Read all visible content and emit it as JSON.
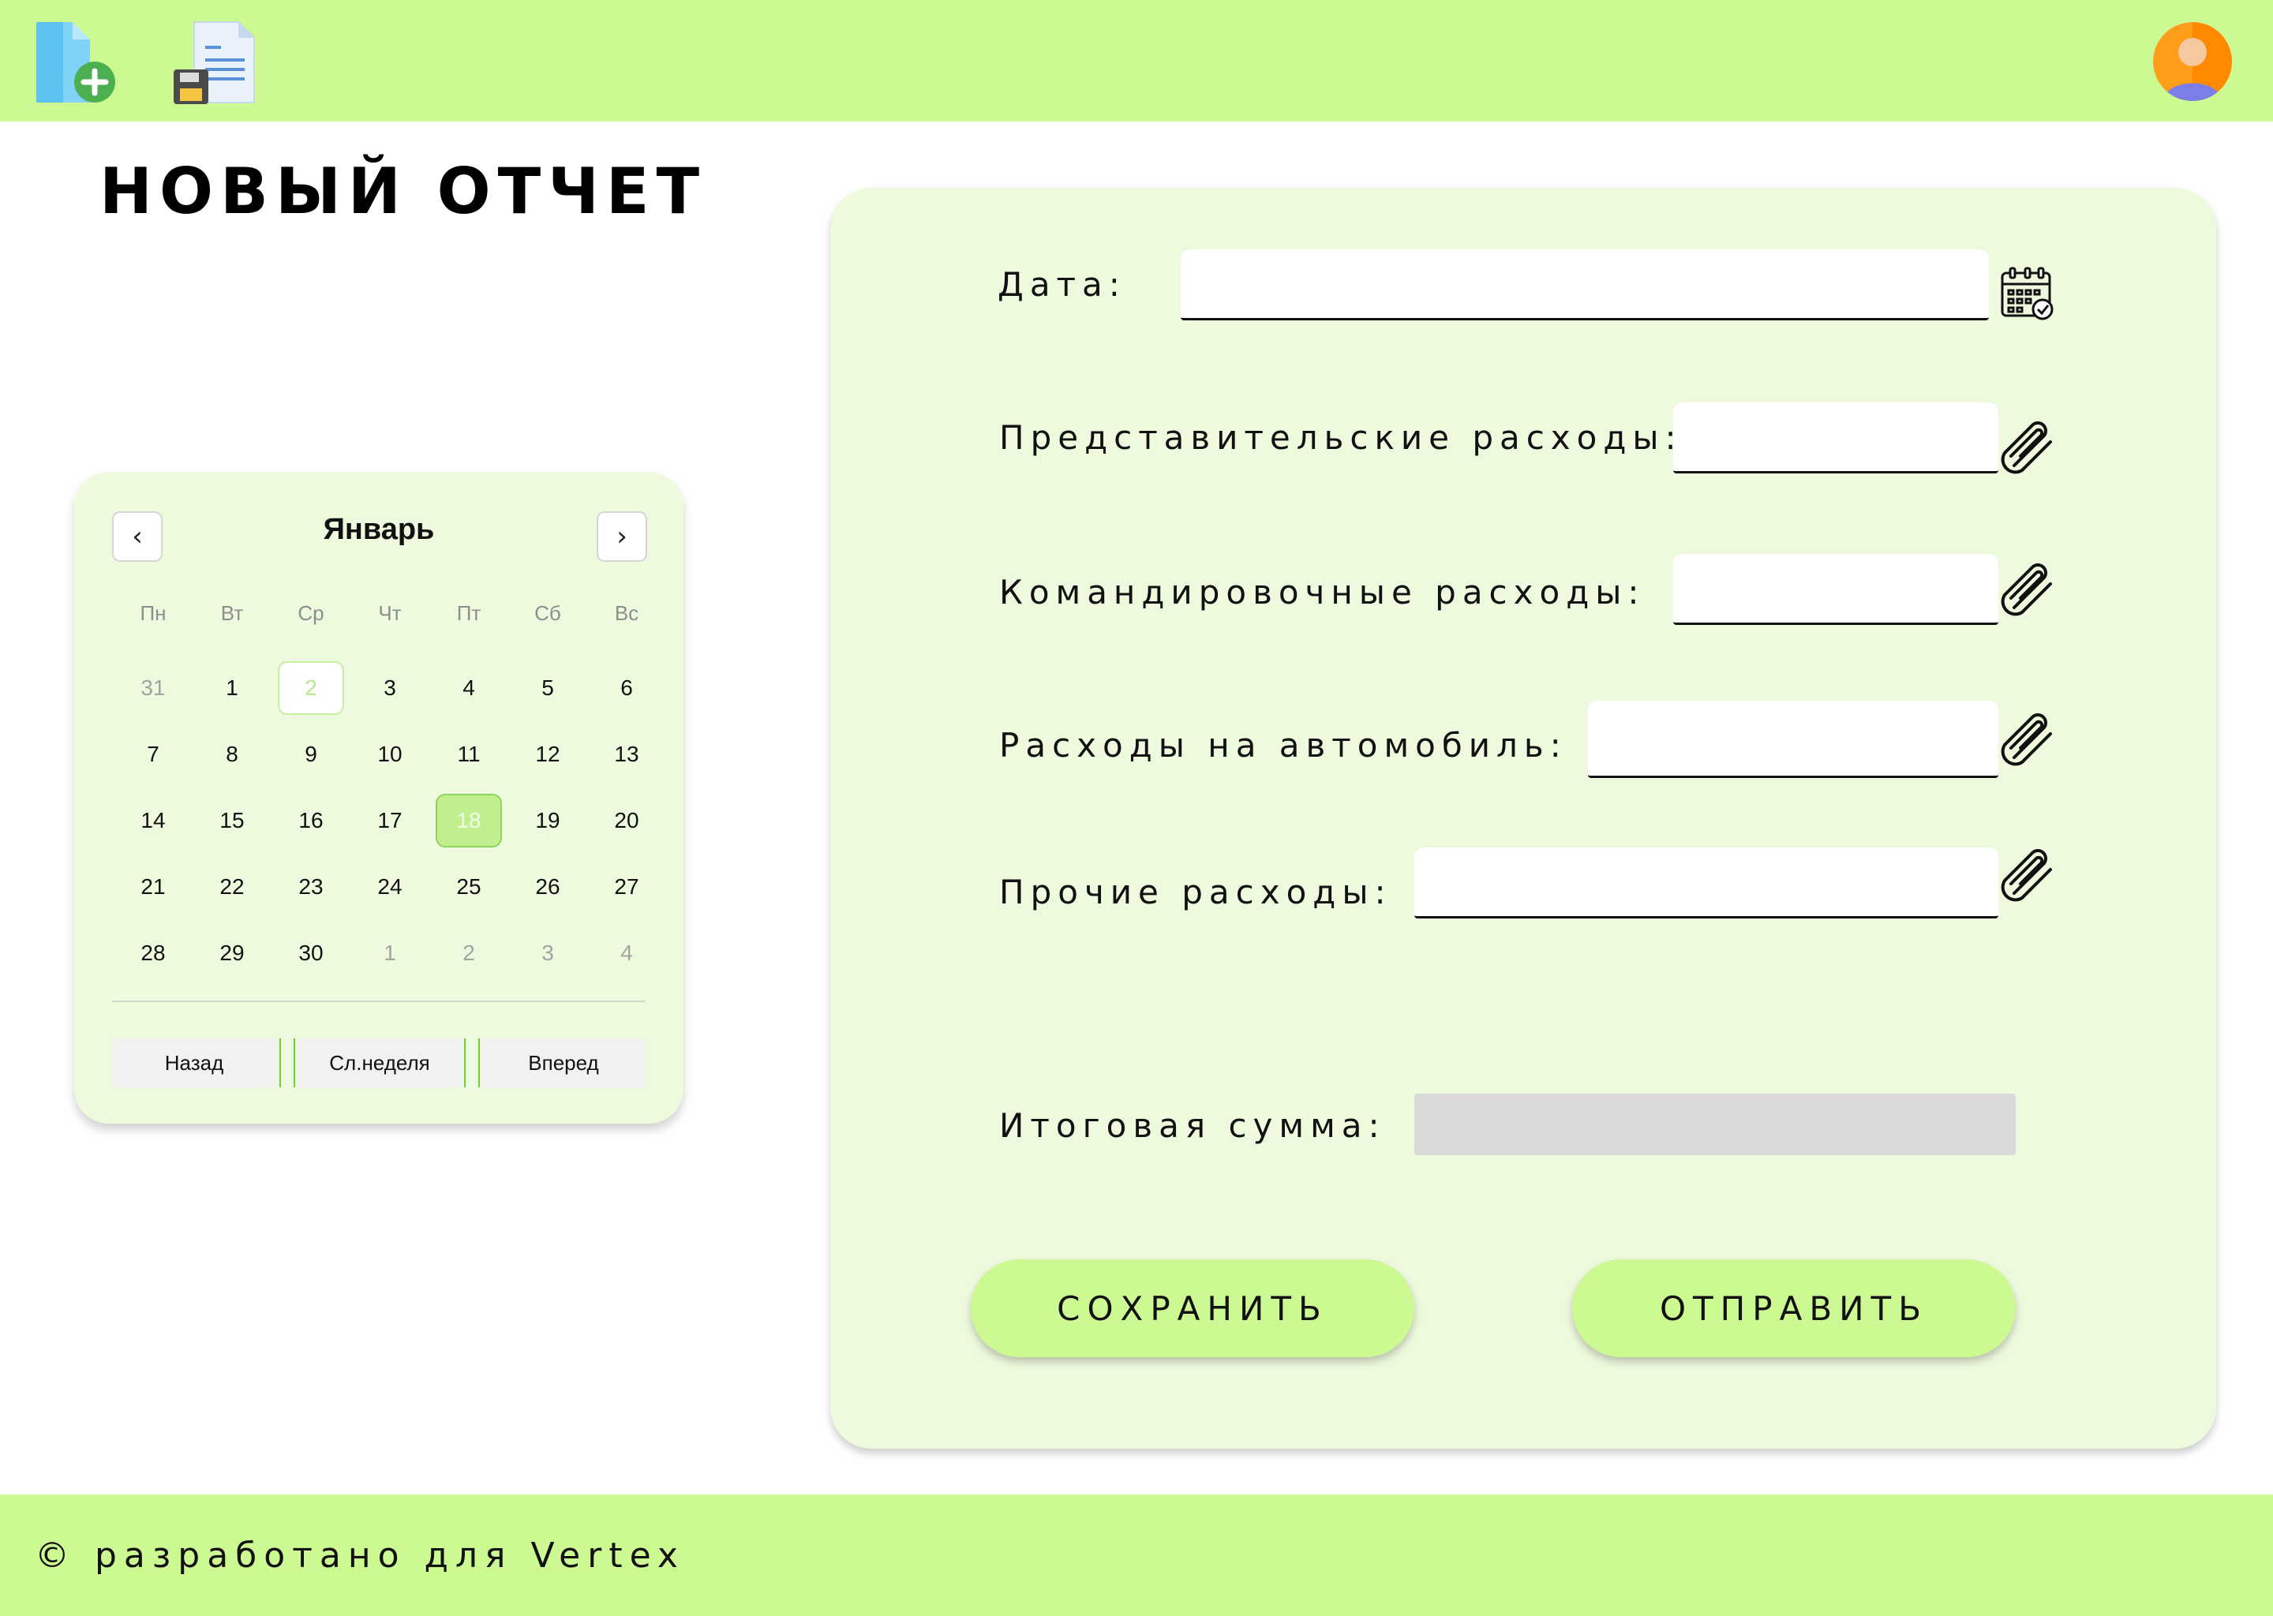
{
  "header": {
    "icons": [
      "new-document-icon",
      "save-document-icon"
    ],
    "avatar": "user-avatar"
  },
  "page": {
    "title": "НОВЫЙ ОТЧЕТ"
  },
  "calendar": {
    "month": "Январь",
    "prev_icon": "‹",
    "next_icon": "›",
    "weekdays": [
      "Пн",
      "Вт",
      "Ср",
      "Чт",
      "Пт",
      "Сб",
      "Вс"
    ],
    "days": [
      "31",
      "1",
      "2",
      "3",
      "4",
      "5",
      "6",
      "7",
      "8",
      "9",
      "10",
      "11",
      "12",
      "13",
      "14",
      "15",
      "16",
      "17",
      "18",
      "19",
      "20",
      "21",
      "22",
      "23",
      "24",
      "25",
      "26",
      "27",
      "28",
      "29",
      "30",
      "1",
      "2",
      "3",
      "4"
    ],
    "today": "2",
    "selected": "18",
    "buttons": {
      "back": "Назад",
      "next_week": "Сл.неделя",
      "forward": "Вперед"
    }
  },
  "form": {
    "date_label": "Дата:",
    "date_value": "",
    "representation_label": "Представительские расходы:",
    "representation_value": "",
    "travel_label": "Командировочные расходы:",
    "travel_value": "",
    "car_label": "Расходы на автомобиль:",
    "car_value": "",
    "other_label": "Прочие расходы:",
    "other_value": "",
    "total_label": "Итоговая сумма:",
    "total_value": "",
    "save_button": "СОХРАНИТЬ",
    "send_button": "ОТПРАВИТЬ"
  },
  "footer": {
    "text": "© разработано для Vertex"
  },
  "colors": {
    "accent": "#ccf992",
    "panel": "#eefade",
    "selected_day": "#c2ef8e",
    "total_field": "#d9d9d9"
  }
}
